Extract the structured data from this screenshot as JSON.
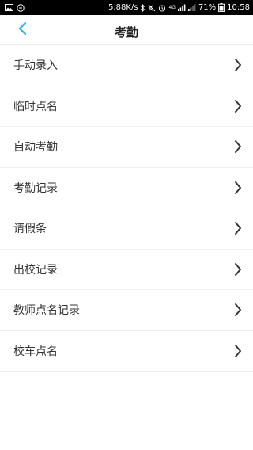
{
  "status_bar": {
    "speed": "5.88K/s",
    "network": "4G",
    "battery": "71%",
    "time": "10:58",
    "icons": [
      "image-icon",
      "message-icon",
      "bluetooth-icon",
      "mute-icon",
      "alarm-icon",
      "signal-icon",
      "signal-icon-2",
      "battery-icon"
    ]
  },
  "header": {
    "title": "考勤",
    "back_icon": "chevron-left-icon",
    "accent_color": "#3cb8e0"
  },
  "menu": {
    "items": [
      {
        "label": "手动录入"
      },
      {
        "label": "临时点名"
      },
      {
        "label": "自动考勤"
      },
      {
        "label": "考勤记录"
      },
      {
        "label": "请假条"
      },
      {
        "label": "出校记录"
      },
      {
        "label": "教师点名记录"
      },
      {
        "label": "校车点名"
      }
    ],
    "item_icon": "chevron-right-icon"
  }
}
